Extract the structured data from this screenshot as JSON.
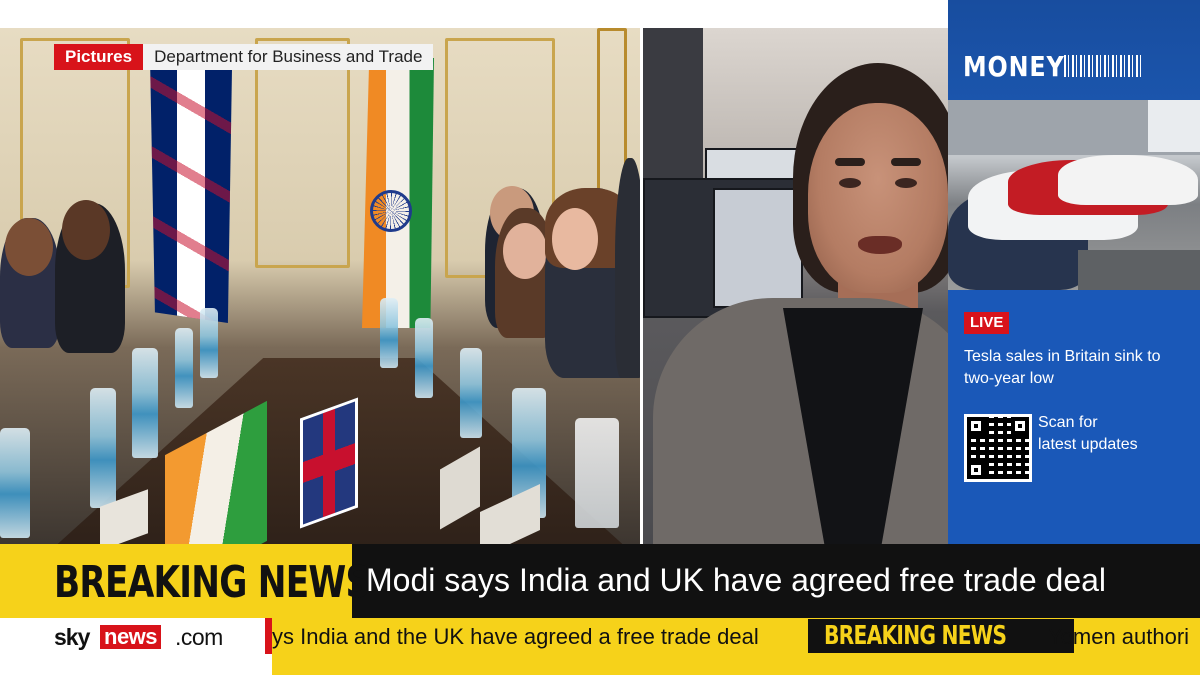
{
  "left_panel": {
    "tag_label": "Pictures",
    "tag_source": "Department for Business and Trade"
  },
  "money_panel": {
    "title": "MONEY",
    "live_label": "LIVE",
    "headline": "Tesla sales in Britain sink to two-year low",
    "scan_text": "Scan for latest updates",
    "icons": [
      "barcode-icon",
      "qr-code-icon"
    ]
  },
  "breaking": {
    "label": "BREAKING NEWS",
    "headline": "Modi says India and UK have agreed free trade deal"
  },
  "ticker": {
    "logo_sky": "sky",
    "logo_news": "news",
    "logo_com": ".com",
    "item1": "ys India and the UK have agreed a free trade deal",
    "badge": "BREAKING NEWS",
    "item2": "Yemen authori"
  },
  "colors": {
    "sky_red": "#d8131a",
    "breaking_yellow": "#f6d21a",
    "money_blue": "#1a58b8",
    "bar_black": "#111111"
  }
}
